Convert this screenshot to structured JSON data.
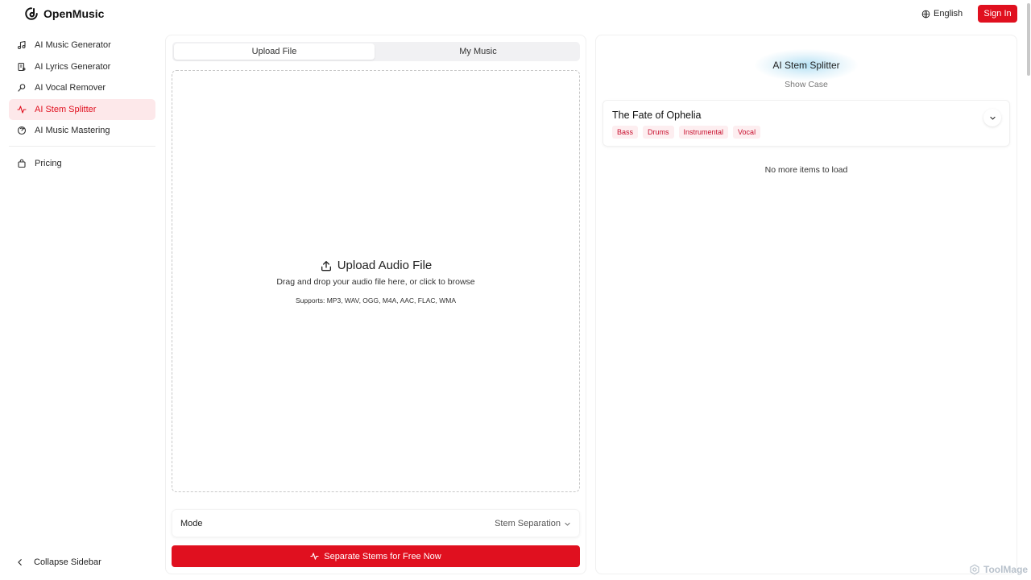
{
  "brand": {
    "name": "OpenMusic"
  },
  "header": {
    "language": "English",
    "signin_label": "Sign In"
  },
  "sidebar": {
    "items": [
      {
        "label": "AI Music Generator",
        "icon": "music-note-icon",
        "active": false
      },
      {
        "label": "AI Lyrics Generator",
        "icon": "lyrics-icon",
        "active": false
      },
      {
        "label": "AI Vocal Remover",
        "icon": "microphone-icon",
        "active": false
      },
      {
        "label": "AI Stem Splitter",
        "icon": "waveform-icon",
        "active": true
      },
      {
        "label": "AI Music Mastering",
        "icon": "mastering-icon",
        "active": false
      }
    ],
    "pricing_label": "Pricing",
    "collapse_label": "Collapse Sidebar"
  },
  "upload": {
    "tabs": [
      {
        "label": "Upload File",
        "active": true
      },
      {
        "label": "My Music",
        "active": false
      }
    ],
    "dropzone_title": "Upload Audio File",
    "dropzone_subtitle": "Drag and drop your audio file here, or click to browse",
    "dropzone_formats": "Supports: MP3, WAV, OGG, M4A, AAC, FLAC, WMA",
    "mode_label": "Mode",
    "mode_value": "Stem Separation",
    "cta_label": "Separate Stems for Free Now"
  },
  "showcase": {
    "title": "AI Stem Splitter",
    "subtitle": "Show Case",
    "card": {
      "title": "The Fate of Ophelia",
      "tags": [
        "Bass",
        "Drums",
        "Instrumental",
        "Vocal"
      ]
    },
    "end_message": "No more items to load"
  },
  "watermark": "ToolMage",
  "colors": {
    "accent": "#e0101f",
    "active_bg": "#fde8ea",
    "tag_bg": "#fdeef0",
    "tag_text": "#c8102e"
  }
}
